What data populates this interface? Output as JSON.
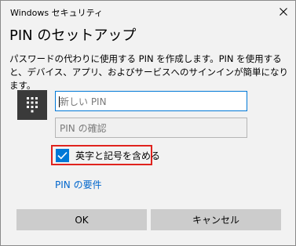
{
  "window": {
    "app_title": "Windows セキュリティ",
    "heading": "PIN のセットアップ"
  },
  "description": "パスワードの代わりに使用する PIN を作成します。PIN を使用すると、デバイス、アプリ、およびサービスへのサインインが簡単になります。",
  "fields": {
    "new_pin_placeholder": "新しい PIN",
    "confirm_pin_placeholder": "PIN の確認"
  },
  "checkbox": {
    "label": "英字と記号を含める",
    "checked": true
  },
  "link": {
    "label": "PIN の要件"
  },
  "buttons": {
    "ok": "OK",
    "cancel": "キャンセル"
  },
  "colors": {
    "accent": "#0078d7",
    "highlight": "#e0231e"
  }
}
